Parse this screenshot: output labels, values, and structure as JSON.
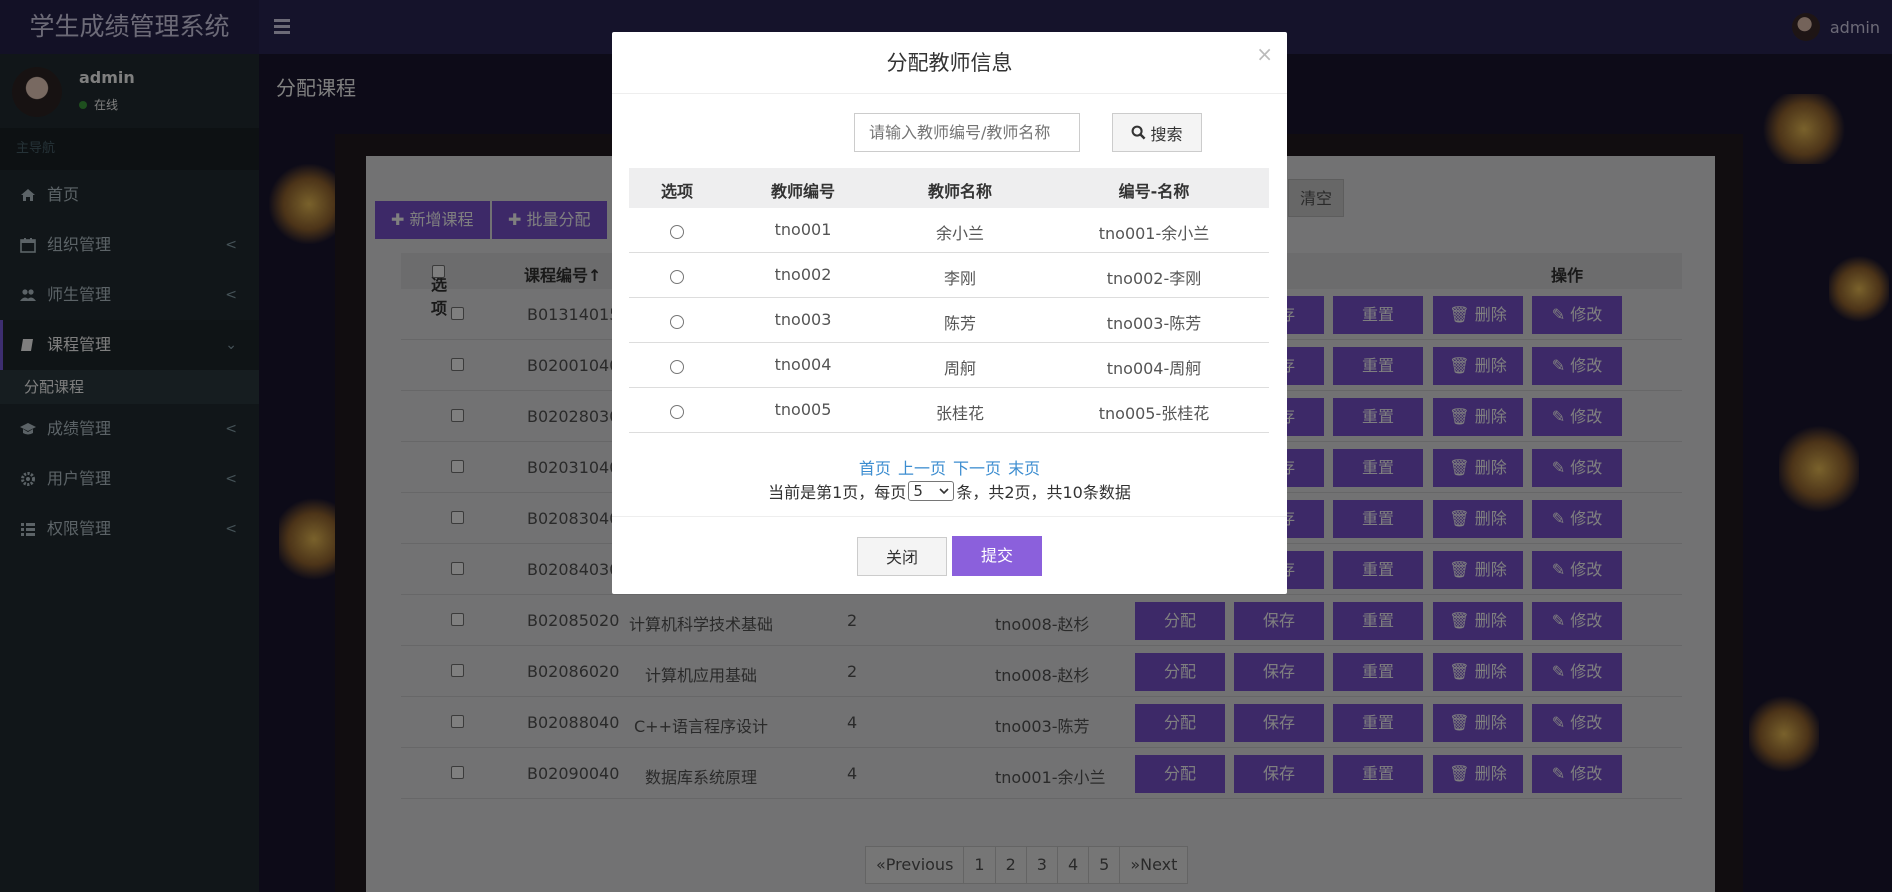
{
  "app_title": "学生成绩管理系统",
  "header": {
    "username": "admin"
  },
  "sidebar": {
    "user": {
      "name": "admin",
      "status": "在线"
    },
    "nav_header": "主导航",
    "items": [
      {
        "label": "首页",
        "icon": "home-icon"
      },
      {
        "label": "组织管理",
        "icon": "calendar-icon"
      },
      {
        "label": "师生管理",
        "icon": "users-icon"
      },
      {
        "label": "课程管理",
        "icon": "book-icon"
      },
      {
        "label": "成绩管理",
        "icon": "graduation-cap-icon"
      },
      {
        "label": "用户管理",
        "icon": "gear-icon"
      },
      {
        "label": "权限管理",
        "icon": "list-icon"
      }
    ],
    "sub_item": "分配课程"
  },
  "page": {
    "breadcrumb": "分配课程",
    "toolbar": {
      "add": "新增课程",
      "batch": "批量分配",
      "clear": "清空"
    },
    "table": {
      "headers": {
        "select": "选项",
        "code": "课程编号↑",
        "action": "操作"
      },
      "rows": [
        {
          "code": "B01314015",
          "name": "",
          "credit": "",
          "teacher": ""
        },
        {
          "code": "B02001040",
          "name": "",
          "credit": "",
          "teacher": ""
        },
        {
          "code": "B02028030",
          "name": "",
          "credit": "",
          "teacher": ""
        },
        {
          "code": "B02031040",
          "name": "",
          "credit": "",
          "teacher": ""
        },
        {
          "code": "B02083040",
          "name": "",
          "credit": "",
          "teacher": ""
        },
        {
          "code": "B02084030",
          "name": "",
          "credit": "",
          "teacher": ""
        },
        {
          "code": "B02085020",
          "name": "计算机科学技术基础",
          "credit": "2",
          "teacher": "tno008-赵杉"
        },
        {
          "code": "B02086020",
          "name": "计算机应用基础",
          "credit": "2",
          "teacher": "tno008-赵杉"
        },
        {
          "code": "B02088040",
          "name": "C++语言程序设计",
          "credit": "4",
          "teacher": "tno003-陈芳"
        },
        {
          "code": "B02090040",
          "name": "数据库系统原理",
          "credit": "4",
          "teacher": "tno001-余小兰"
        }
      ],
      "actions": {
        "assign": "分配",
        "save": "保存",
        "reset": "重置",
        "delete": "删除",
        "edit": "修改"
      }
    },
    "pagination": [
      "«Previous",
      "1",
      "2",
      "3",
      "4",
      "5",
      "»Next"
    ]
  },
  "modal": {
    "title": "分配教师信息",
    "close_symbol": "×",
    "search_placeholder": "请输入教师编号/教师名称",
    "search_button": "搜索",
    "headers": [
      "选项",
      "教师编号",
      "教师名称",
      "编号-名称"
    ],
    "rows": [
      {
        "no": "tno001",
        "name": "余小兰",
        "combo": "tno001-余小兰"
      },
      {
        "no": "tno002",
        "name": "李刚",
        "combo": "tno002-李刚"
      },
      {
        "no": "tno003",
        "name": "陈芳",
        "combo": "tno003-陈芳"
      },
      {
        "no": "tno004",
        "name": "周舸",
        "combo": "tno004-周舸"
      },
      {
        "no": "tno005",
        "name": "张桂花",
        "combo": "tno005-张桂花"
      }
    ],
    "pager_links": [
      "首页",
      "上一页",
      "下一页",
      "末页"
    ],
    "pager_info": {
      "prefix": "当前是第1页，每页",
      "page_size": "5",
      "suffix": "条，共2页，共10条数据"
    },
    "close_button": "关闭",
    "submit_button": "提交"
  },
  "colors": {
    "accent": "#7b52d0",
    "header_bg": "#2b2756",
    "sidebar_bg": "#222d32",
    "link": "#3c8dd0"
  }
}
